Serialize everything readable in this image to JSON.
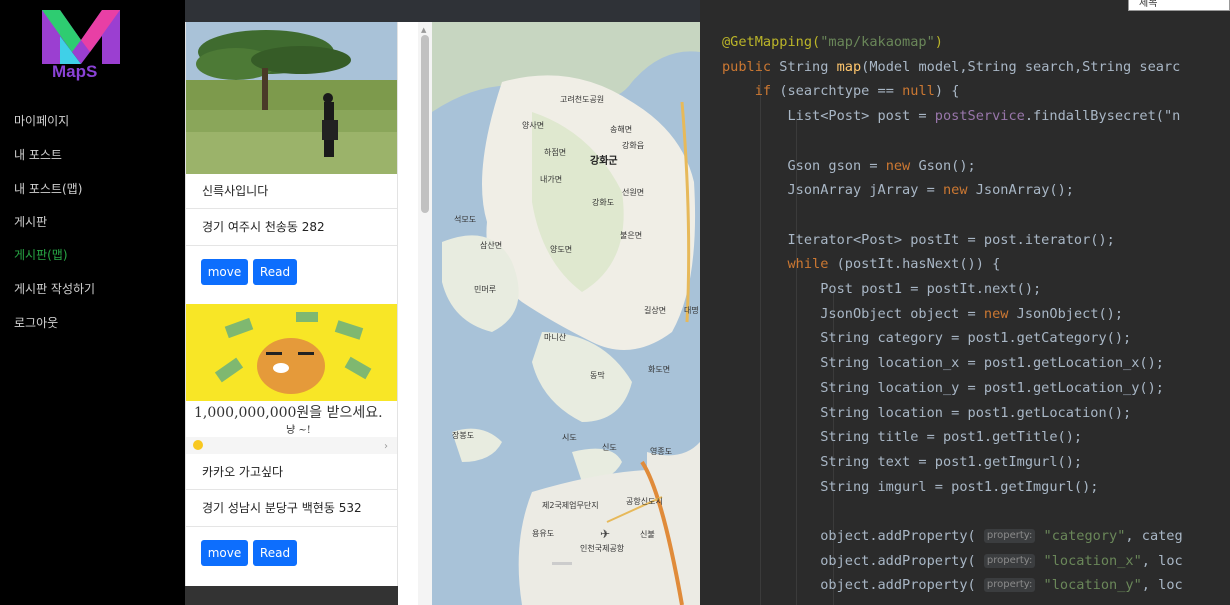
{
  "sidebar": {
    "logo_text": "MapS",
    "items": [
      {
        "label": "마이페이지",
        "active": false
      },
      {
        "label": "내 포스트",
        "active": false
      },
      {
        "label": "내 포스트(맵)",
        "active": false
      },
      {
        "label": "게시판",
        "active": false
      },
      {
        "label": "게시판(맵)",
        "active": true
      },
      {
        "label": "게시판 작성하기",
        "active": false
      },
      {
        "label": "로그아웃",
        "active": false
      }
    ],
    "active_color": "#28a745"
  },
  "search": {
    "selected": "제목"
  },
  "posts": [
    {
      "title": "신륵사입니다",
      "address": "경기 여주시 천송동 282",
      "move_label": "move",
      "read_label": "Read"
    },
    {
      "title": "카카오 가고싶다",
      "address": "경기 성남시 분당구 백현동 532",
      "move_label": "move",
      "read_label": "Read",
      "image_caption": "1,000,000,000원을 받으세요.",
      "image_sub": "냥 ~!"
    }
  ],
  "map": {
    "labels": [
      "양사면",
      "고려천도공원",
      "송해면",
      "하점면",
      "강화읍",
      "강화군",
      "내가면",
      "선원면",
      "강화도",
      "석모도",
      "삼산면",
      "불은면",
      "양도면",
      "민머루",
      "길상면",
      "대명",
      "마니산",
      "동막",
      "화도면",
      "장봉도",
      "시도",
      "신도",
      "영종도",
      "제2국제업무단지",
      "공항신도시",
      "용유도",
      "신불",
      "인천국제공항"
    ]
  },
  "code": {
    "lines": [
      [
        {
          "t": "@GetMapping(",
          "c": "ann"
        },
        {
          "t": "\"map/kakaomap\"",
          "c": "str"
        },
        {
          "t": ")",
          "c": "ann"
        }
      ],
      [
        {
          "t": "public ",
          "c": "kw"
        },
        {
          "t": "String "
        },
        {
          "t": "map",
          "c": "fn"
        },
        {
          "t": "(Model model,String search,String searc"
        }
      ],
      [
        {
          "t": "    "
        },
        {
          "t": "if ",
          "c": "kw"
        },
        {
          "t": "(searchtype == "
        },
        {
          "t": "null",
          "c": "kw"
        },
        {
          "t": ") {"
        }
      ],
      [
        {
          "t": "        List<Post> post = "
        },
        {
          "t": "postService",
          "c": "var"
        },
        {
          "t": ".findallBysecret(\"n"
        }
      ],
      [
        {
          "t": ""
        }
      ],
      [
        {
          "t": "        Gson gson = "
        },
        {
          "t": "new ",
          "c": "kw"
        },
        {
          "t": "Gson();"
        }
      ],
      [
        {
          "t": "        JsonArray jArray = "
        },
        {
          "t": "new ",
          "c": "kw"
        },
        {
          "t": "JsonArray();"
        }
      ],
      [
        {
          "t": ""
        }
      ],
      [
        {
          "t": "        Iterator<Post> postIt = post.iterator();"
        }
      ],
      [
        {
          "t": "        "
        },
        {
          "t": "while ",
          "c": "kw"
        },
        {
          "t": "(postIt.hasNext()) {"
        }
      ],
      [
        {
          "t": "            Post post1 = postIt.next();"
        }
      ],
      [
        {
          "t": "            JsonObject object = "
        },
        {
          "t": "new ",
          "c": "kw"
        },
        {
          "t": "JsonObject();"
        }
      ],
      [
        {
          "t": "            String category = post1.getCategory();"
        }
      ],
      [
        {
          "t": "            String location_x = post1.getLocation_x();"
        }
      ],
      [
        {
          "t": "            String location_y = post1.getLocation_y();"
        }
      ],
      [
        {
          "t": "            String location = post1.getLocation();"
        }
      ],
      [
        {
          "t": "            String title = post1.getTitle();"
        }
      ],
      [
        {
          "t": "            String text = post1.getImgurl();"
        }
      ],
      [
        {
          "t": "            String imgurl = post1.getImgurl();"
        }
      ],
      [
        {
          "t": ""
        }
      ],
      [
        {
          "t": "            object.addProperty( "
        },
        {
          "t": "property:",
          "c": "hint"
        },
        {
          "t": " "
        },
        {
          "t": "\"category\"",
          "c": "str"
        },
        {
          "t": ", categ"
        }
      ],
      [
        {
          "t": "            object.addProperty( "
        },
        {
          "t": "property:",
          "c": "hint"
        },
        {
          "t": " "
        },
        {
          "t": "\"location_x\"",
          "c": "str"
        },
        {
          "t": ", loc"
        }
      ],
      [
        {
          "t": "            object.addProperty( "
        },
        {
          "t": "property:",
          "c": "hint"
        },
        {
          "t": " "
        },
        {
          "t": "\"location_y\"",
          "c": "str"
        },
        {
          "t": ", loc"
        }
      ]
    ]
  }
}
